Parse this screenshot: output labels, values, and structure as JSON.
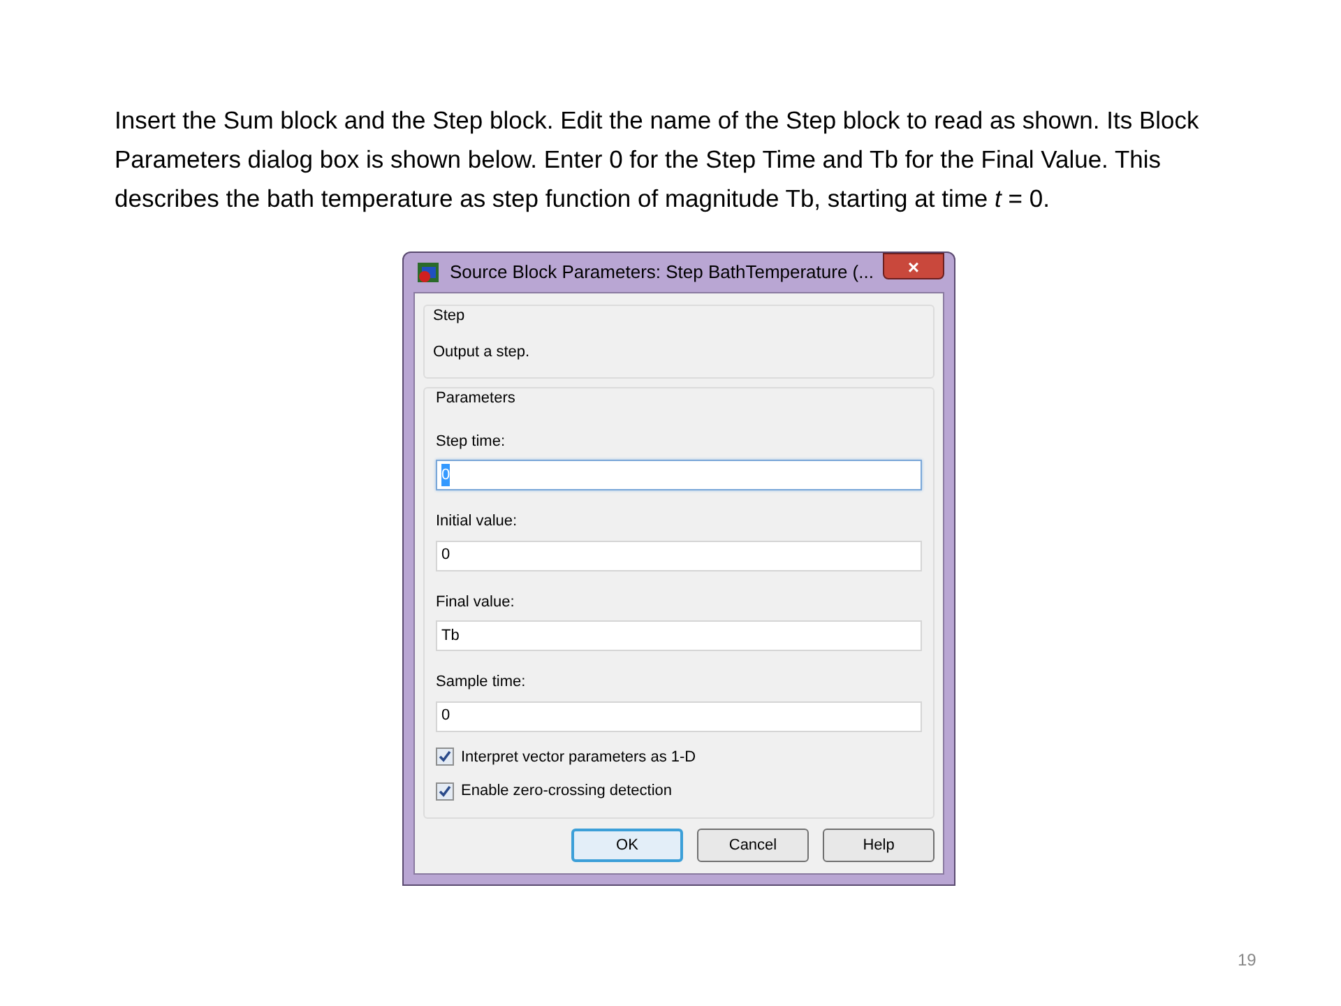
{
  "slide": {
    "text": "Insert the Sum block and the Step block.  Edit the name of the Step block to read as shown.  Its Block Parameters dialog box is shown below. Enter 0 for the Step Time and Tb for the Final Value.  This describes the bath temperature as step function of magnitude Tb, starting at time *t* = 0.",
    "page_number": "19"
  },
  "dialog": {
    "title": "Source Block Parameters: Step BathTemperature (...",
    "close": "×",
    "groups": [
      {
        "title": "Step",
        "description": "Output a step."
      }
    ],
    "parameters": {
      "title": "Parameters",
      "fields": [
        {
          "label": "Step time:",
          "value": "0",
          "focused": true
        },
        {
          "label": "Initial value:",
          "value": "0",
          "focused": false
        },
        {
          "label": "Final value:",
          "value": "Tb",
          "focused": false
        },
        {
          "label": "Sample time:",
          "value": "0",
          "focused": false
        }
      ],
      "checkboxes": [
        {
          "label": "Interpret vector parameters as 1-D",
          "checked": true
        },
        {
          "label": "Enable zero-crossing detection",
          "checked": true
        }
      ]
    },
    "buttons": [
      {
        "label": "OK",
        "default": true
      },
      {
        "label": "Cancel",
        "default": false
      },
      {
        "label": "Help",
        "default": false
      }
    ]
  }
}
